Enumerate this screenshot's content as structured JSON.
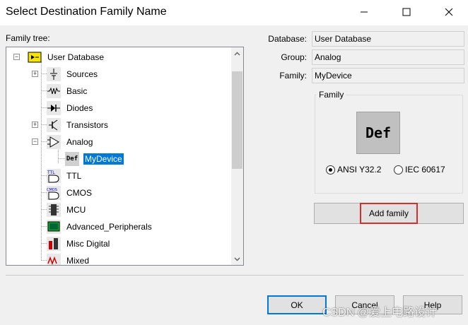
{
  "window": {
    "title": "Select Destination Family Name",
    "controls": [
      "minimize-icon",
      "maximize-icon",
      "close-icon"
    ]
  },
  "tree": {
    "label": "Family tree:",
    "items": [
      {
        "label": "User Database",
        "icon": "database-icon",
        "expander": "⊟"
      },
      {
        "label": "Sources",
        "icon": "sources-icon",
        "expander": "⊞"
      },
      {
        "label": "Basic",
        "icon": "resistor-icon",
        "expander": ""
      },
      {
        "label": "Diodes",
        "icon": "diode-icon",
        "expander": ""
      },
      {
        "label": "Transistors",
        "icon": "transistor-icon",
        "expander": "⊞"
      },
      {
        "label": "Analog",
        "icon": "opamp-icon",
        "expander": "⊟"
      },
      {
        "label": "MyDevice",
        "icon": "def-icon",
        "expander": "",
        "selected": true
      },
      {
        "label": "TTL",
        "icon": "ttl-icon",
        "expander": ""
      },
      {
        "label": "CMOS",
        "icon": "cmos-icon",
        "expander": ""
      },
      {
        "label": "MCU",
        "icon": "mcu-icon",
        "expander": ""
      },
      {
        "label": "Advanced_Peripherals",
        "icon": "peripherals-icon",
        "expander": ""
      },
      {
        "label": "Misc Digital",
        "icon": "misc-digital-icon",
        "expander": ""
      },
      {
        "label": "Mixed",
        "icon": "mixed-icon",
        "expander": ""
      }
    ]
  },
  "info": {
    "database_label": "Database:",
    "database_value": "User Database",
    "group_label": "Group:",
    "group_value": "Analog",
    "family_label": "Family:",
    "family_value": "MyDevice"
  },
  "family_group": {
    "title": "Family",
    "preview_text": "Def",
    "radio_ansi": "ANSI Y32.2",
    "radio_iec": "IEC 60617",
    "selected_standard": "ANSI Y32.2"
  },
  "buttons": {
    "add_family": "Add family",
    "ok": "OK",
    "cancel": "Cancel",
    "help": "Help"
  },
  "watermark": "CSDN @爱上电路设计",
  "colors": {
    "selection": "#0078d7",
    "highlight_box": "#d32f2f"
  }
}
